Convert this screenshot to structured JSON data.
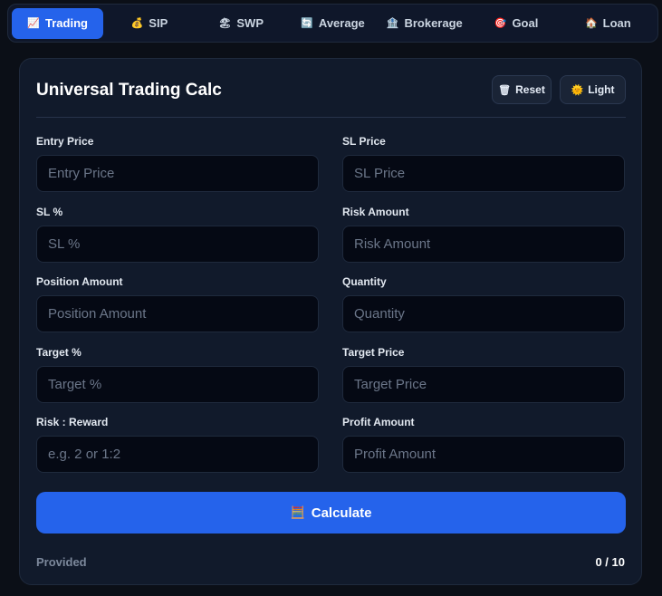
{
  "tabs": [
    {
      "icon": "📈",
      "label": "Trading",
      "active": true
    },
    {
      "icon": "💰",
      "label": "SIP"
    },
    {
      "icon": "🏖",
      "label": "SWP"
    },
    {
      "icon": "🔄",
      "label": "Average"
    },
    {
      "icon": "🏦",
      "label": "Brokerage"
    },
    {
      "icon": "🎯",
      "label": "Goal"
    },
    {
      "icon": "🏠",
      "label": "Loan"
    }
  ],
  "card": {
    "title": "Universal Trading Calc",
    "reset": {
      "icon": "🗑",
      "label": "Reset"
    },
    "light": {
      "icon": "🌞",
      "label": "Light"
    }
  },
  "fields": [
    {
      "label": "Entry Price",
      "placeholder": "Entry Price"
    },
    {
      "label": "SL Price",
      "placeholder": "SL Price"
    },
    {
      "label": "SL %",
      "placeholder": "SL %"
    },
    {
      "label": "Risk Amount",
      "placeholder": "Risk Amount"
    },
    {
      "label": "Position Amount",
      "placeholder": "Position Amount"
    },
    {
      "label": "Quantity",
      "placeholder": "Quantity"
    },
    {
      "label": "Target %",
      "placeholder": "Target %"
    },
    {
      "label": "Target Price",
      "placeholder": "Target Price"
    },
    {
      "label": "Risk : Reward",
      "placeholder": "e.g. 2 or 1:2"
    },
    {
      "label": "Profit Amount",
      "placeholder": "Profit Amount"
    }
  ],
  "calculate": {
    "icon": "🧮",
    "label": "Calculate"
  },
  "footer": {
    "left": "Provided",
    "right": "0 / 10"
  }
}
